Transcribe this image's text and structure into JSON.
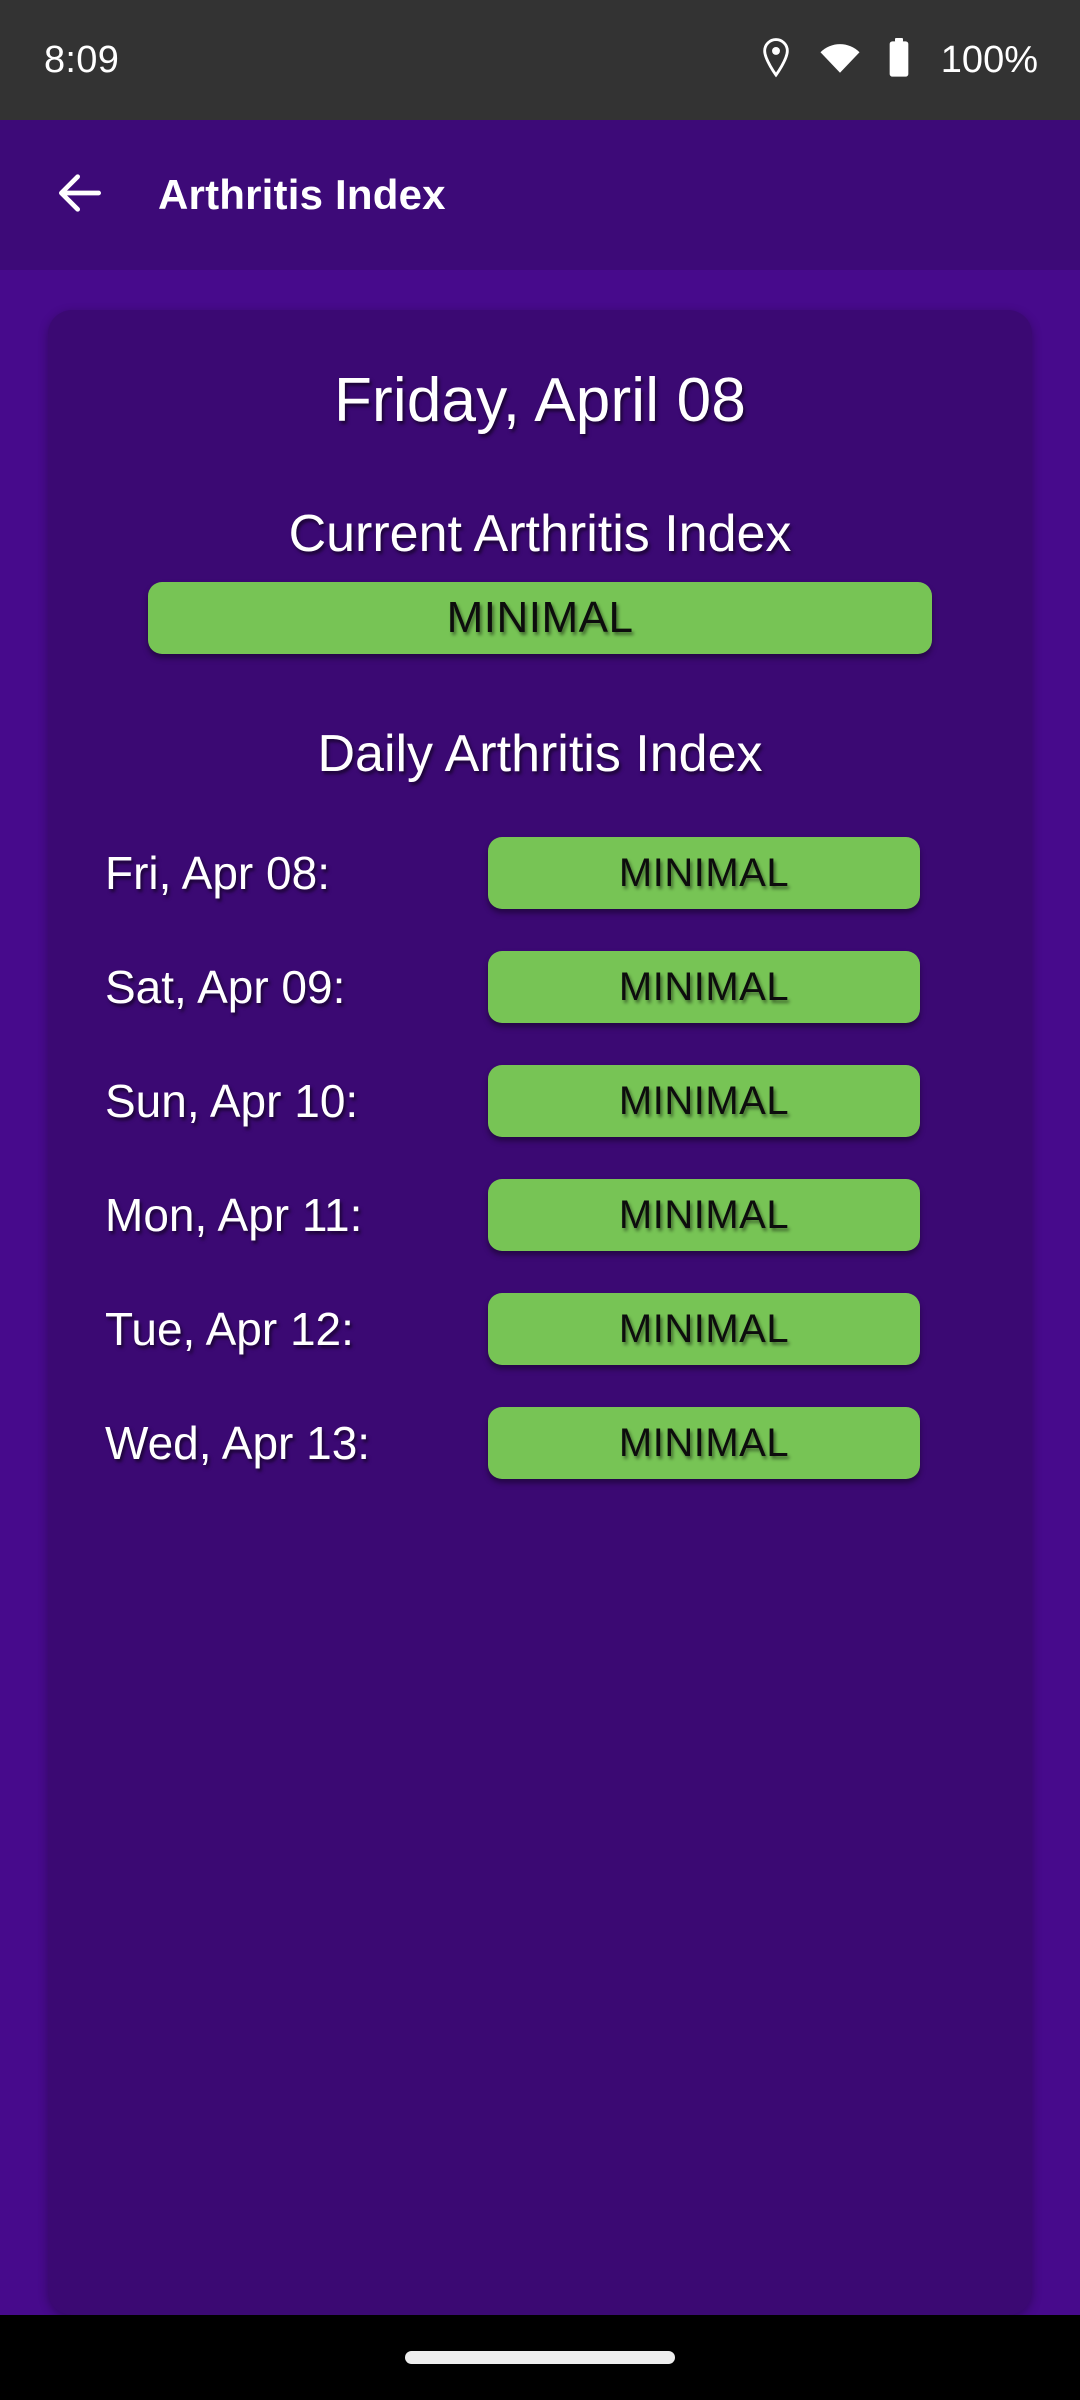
{
  "status_bar": {
    "clock": "8:09",
    "battery_percent": "100%",
    "icons": [
      "location-pin-icon",
      "wifi-icon",
      "battery-icon"
    ],
    "background_color": "#333333",
    "foreground_color": "#ffffff"
  },
  "app_bar": {
    "title": "Arthritis Index",
    "back_icon": "back-arrow-icon",
    "background_color": "#3D0A78"
  },
  "card": {
    "date_title": "Friday, April 08",
    "background_color": "#3B0973",
    "current": {
      "heading": "Current Arthritis Index",
      "value": "MINIMAL",
      "color": "#77C455"
    },
    "daily": {
      "heading": "Daily Arthritis Index",
      "rows": [
        {
          "label": "Fri, Apr 08:",
          "value": "MINIMAL",
          "color": "#77C455"
        },
        {
          "label": "Sat, Apr 09:",
          "value": "MINIMAL",
          "color": "#77C455"
        },
        {
          "label": "Sun, Apr 10:",
          "value": "MINIMAL",
          "color": "#77C455"
        },
        {
          "label": "Mon, Apr 11:",
          "value": "MINIMAL",
          "color": "#77C455"
        },
        {
          "label": "Tue, Apr 12:",
          "value": "MINIMAL",
          "color": "#77C455"
        },
        {
          "label": "Wed, Apr 13:",
          "value": "MINIMAL",
          "color": "#77C455"
        }
      ]
    }
  },
  "nav_bar": {
    "gesture_handle": "home-gesture-pill",
    "background_color": "#000000"
  },
  "page": {
    "background_color": "#470A8C"
  }
}
